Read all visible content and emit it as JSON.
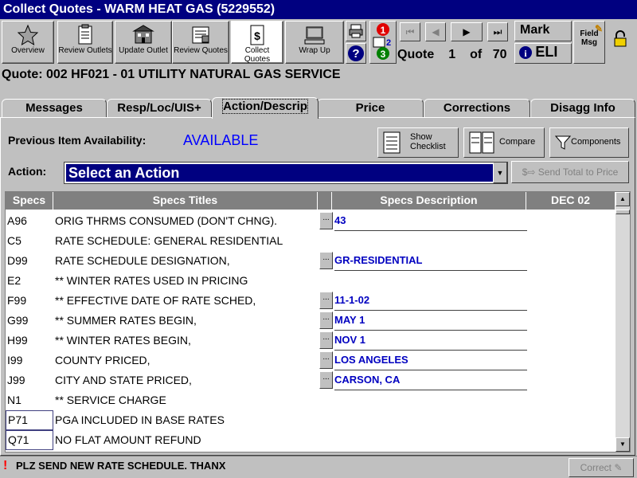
{
  "window": {
    "title": "Collect Quotes -  WARM HEAT GAS (5229552)"
  },
  "toolbar": {
    "overview": "Overview",
    "review_outlets": "Review Outlets",
    "update_outlet": "Update Outlet",
    "review_quotes": "Review Quotes",
    "collect_quotes": "Collect Quotes",
    "wrap_up": "Wrap Up",
    "field_msg": "Field Msg",
    "user_name": "Mark",
    "user_id": "ELI",
    "quote_label": "Quote",
    "quote_current": "1",
    "quote_of": "of",
    "quote_total": "70",
    "badge_1": "1",
    "badge_2": "2",
    "badge_3": "3"
  },
  "quote_header": "Quote: 002   HF021 - 01   UTILITY NATURAL GAS SERVICE",
  "tabs": [
    {
      "label": "Messages"
    },
    {
      "label": "Resp/Loc/UIS+"
    },
    {
      "label": "Action/Descrip"
    },
    {
      "label": "Price"
    },
    {
      "label": "Corrections"
    },
    {
      "label": "Disagg Info"
    }
  ],
  "action_panel": {
    "prev_availability_label": "Previous Item Availability:",
    "prev_availability_value": "AVAILABLE",
    "show_checklist": "Show Checklist",
    "compare": "Compare",
    "components": "Components",
    "action_label": "Action:",
    "action_selected": "Select an Action",
    "send_total": "Send Total to Price"
  },
  "grid": {
    "headers": {
      "specs": "Specs",
      "titles": "Specs Titles",
      "description": "Specs Description",
      "period": "DEC 02"
    },
    "rows": [
      {
        "code": "A96",
        "title": "ORIG THRMS CONSUMED (DON'T CHNG).",
        "desc": "43",
        "editable": true
      },
      {
        "code": "C5",
        "title": "RATE SCHEDULE: GENERAL RESIDENTIAL",
        "desc": "",
        "editable": false
      },
      {
        "code": "D99",
        "title": "RATE SCHEDULE DESIGNATION,",
        "desc": "GR-RESIDENTIAL",
        "editable": true
      },
      {
        "code": "E2",
        "title": "** WINTER RATES USED IN PRICING",
        "desc": "",
        "editable": false
      },
      {
        "code": "F99",
        "title": "** EFFECTIVE DATE OF RATE SCHED,",
        "desc": "11-1-02",
        "editable": true
      },
      {
        "code": "G99",
        "title": "** SUMMER RATES BEGIN,",
        "desc": "MAY 1",
        "editable": true
      },
      {
        "code": "H99",
        "title": "** WINTER RATES BEGIN,",
        "desc": "NOV 1",
        "editable": true
      },
      {
        "code": "I99",
        "title": "COUNTY PRICED,",
        "desc": "LOS ANGELES",
        "editable": true
      },
      {
        "code": "J99",
        "title": "CITY AND STATE PRICED,",
        "desc": "CARSON, CA",
        "editable": true
      },
      {
        "code": "N1",
        "title": "** SERVICE CHARGE",
        "desc": "",
        "editable": false
      },
      {
        "code": "P71",
        "title": "PGA INCLUDED IN BASE RATES",
        "desc": "",
        "editable": false
      },
      {
        "code": "Q71",
        "title": "NO FLAT AMOUNT REFUND",
        "desc": "",
        "editable": false
      }
    ]
  },
  "status": {
    "message": "PLZ SEND NEW RATE SCHEDULE. THANX",
    "correct": "Correct"
  }
}
